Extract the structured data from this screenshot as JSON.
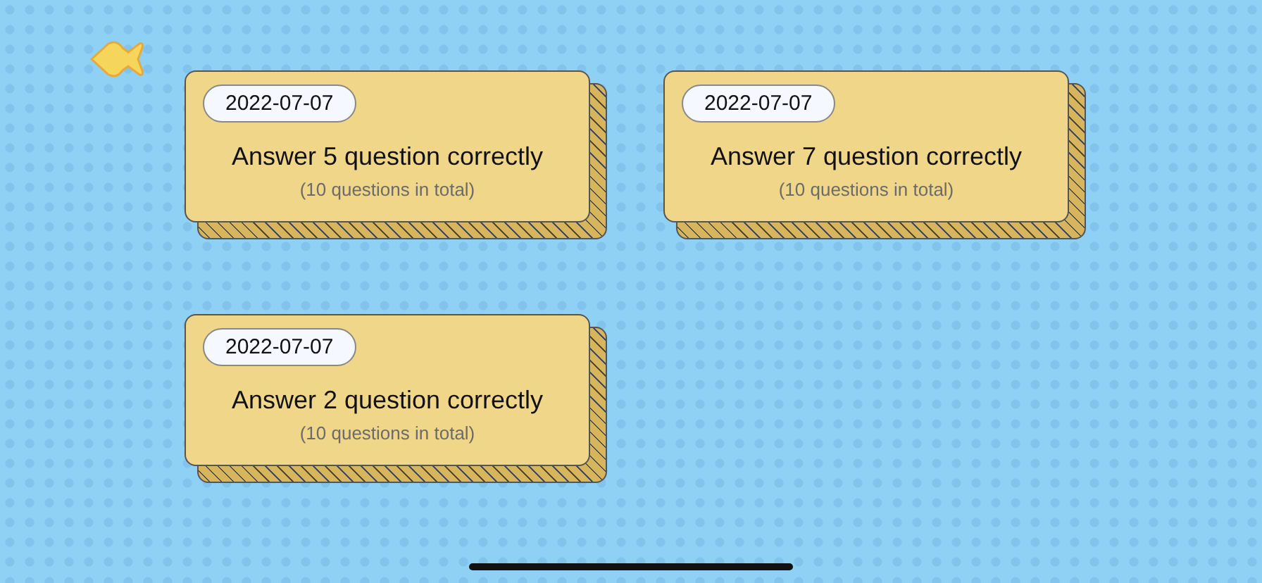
{
  "cards": [
    {
      "date": "2022-07-07",
      "title": "Answer 5 question correctly",
      "subtitle": "(10 questions in total)"
    },
    {
      "date": "2022-07-07",
      "title": "Answer 7 question correctly",
      "subtitle": "(10 questions in total)"
    },
    {
      "date": "2022-07-07",
      "title": "Answer 2 question correctly",
      "subtitle": "(10 questions in total)"
    }
  ]
}
